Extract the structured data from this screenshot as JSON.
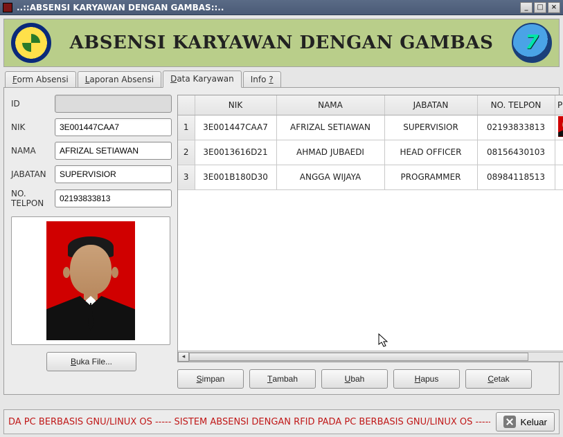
{
  "window": {
    "title": "..::ABSENSI KARYAWAN DENGAN GAMBAS::.."
  },
  "header": {
    "title": "ABSENSI KARYAWAN DENGAN GAMBAS"
  },
  "tabs": [
    {
      "label": "Form Absensi",
      "underline": "F"
    },
    {
      "label": "Laporan Absensi",
      "underline": "L"
    },
    {
      "label": "Data Karyawan",
      "underline": "D"
    },
    {
      "label": "Info ?",
      "underline": "?"
    }
  ],
  "active_tab_index": 2,
  "form": {
    "labels": {
      "id": "ID",
      "nik": "NIK",
      "nama": "NAMA",
      "jabatan": "JABATAN",
      "telpon": "NO. TELPON"
    },
    "values": {
      "id": "",
      "nik": "3E001447CAA7",
      "nama": "AFRIZAL SETIAWAN",
      "jabatan": "SUPERVISIOR",
      "telpon": "02193833813"
    }
  },
  "buttons": {
    "open_file": "Buka File...",
    "simpan": "Simpan",
    "tambah": "Tambah",
    "ubah": "Ubah",
    "hapus": "Hapus",
    "cetak": "Cetak",
    "keluar": "Keluar"
  },
  "grid": {
    "columns": [
      "NIK",
      "NAMA",
      "JABATAN",
      "NO. TELPON",
      "POT"
    ],
    "rows": [
      {
        "n": "1",
        "nik": "3E001447CAA7",
        "nama": "AFRIZAL SETIAWAN",
        "jabatan": "SUPERVISIOR",
        "telpon": "02193833813",
        "has_photo": true
      },
      {
        "n": "2",
        "nik": "3E0013616D21",
        "nama": "AHMAD JUBAEDI",
        "jabatan": "HEAD OFFICER",
        "telpon": "08156430103",
        "has_photo": false
      },
      {
        "n": "3",
        "nik": "3E001B180D30",
        "nama": "ANGGA WIJAYA",
        "jabatan": "PROGRAMMER",
        "telpon": "08984118513",
        "has_photo": false
      }
    ]
  },
  "marquee": "DA PC BERBASIS GNU/LINUX OS ----- SISTEM ABSENSI DENGAN RFID PADA PC BERBASIS GNU/LINUX OS ----- SISTEM"
}
